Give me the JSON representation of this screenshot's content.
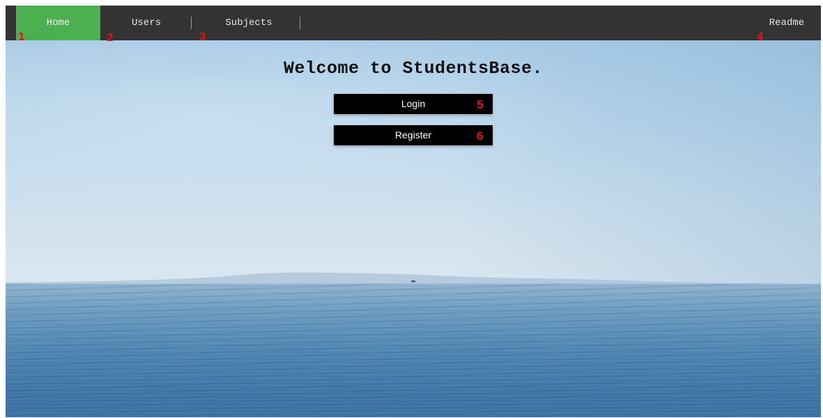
{
  "navbar": {
    "items": [
      {
        "label": "Home",
        "active": true
      },
      {
        "label": "Users",
        "active": false
      },
      {
        "label": "Subjects",
        "active": false
      }
    ],
    "right_item": {
      "label": "Readme"
    }
  },
  "main": {
    "welcome_text": "Welcome to StudentsBase.",
    "buttons": [
      {
        "label": "Login"
      },
      {
        "label": "Register"
      }
    ]
  },
  "markers": [
    "1",
    "2",
    "3",
    "4",
    "5",
    "6"
  ],
  "colors": {
    "navbar_bg": "#333333",
    "active_tab": "#4caf50",
    "marker": "#e11515",
    "button_bg": "#000000"
  }
}
